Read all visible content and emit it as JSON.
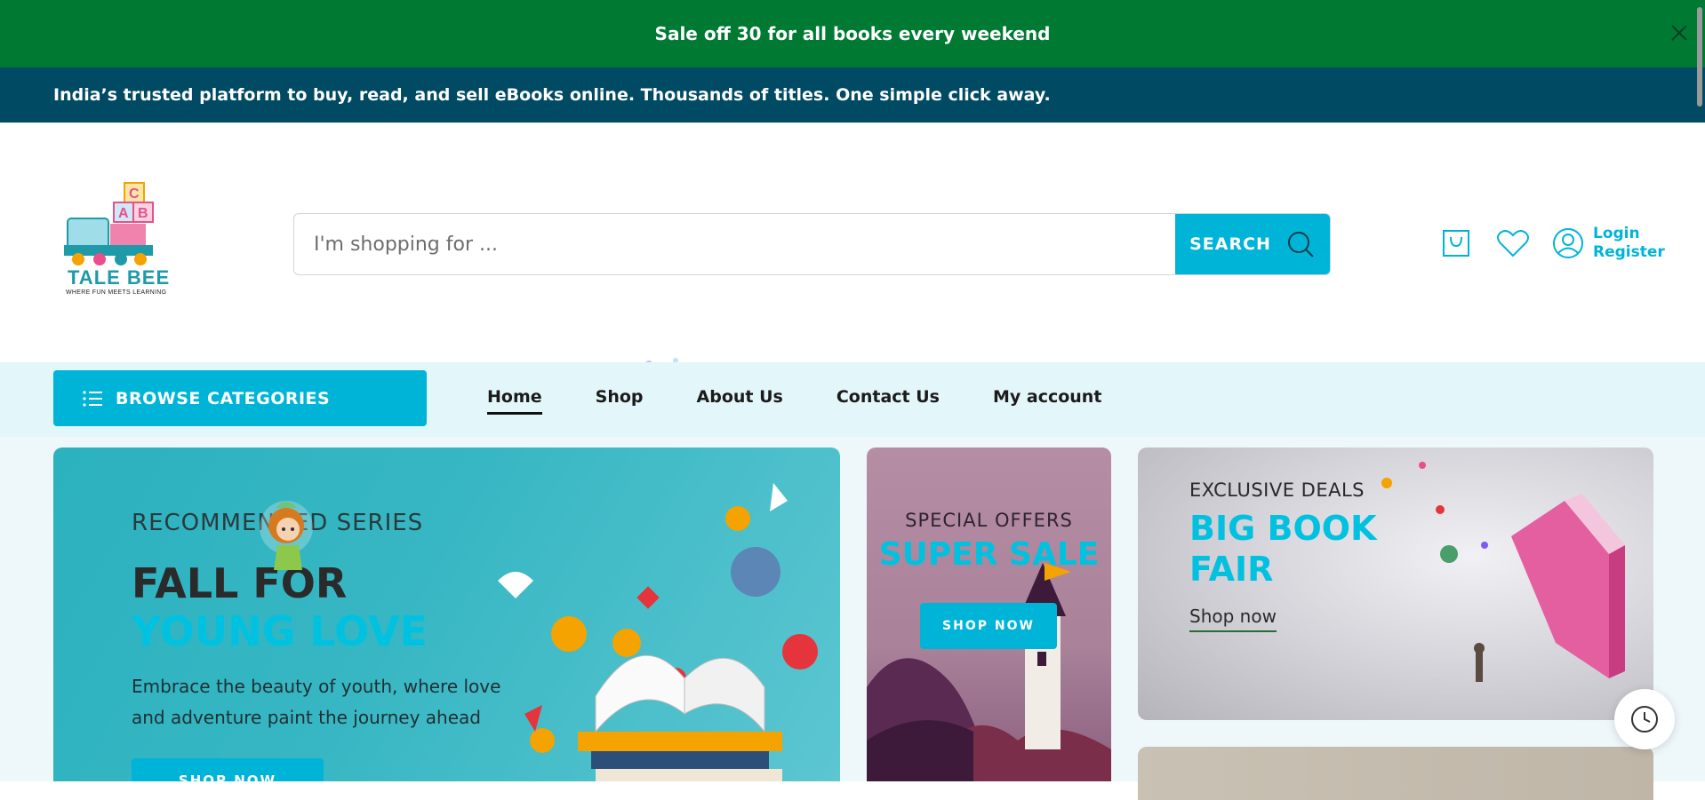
{
  "announcement": {
    "text": "Sale off 30 for all books every weekend"
  },
  "info_bar": {
    "text": "India’s trusted platform to buy, read, and sell eBooks online. Thousands of titles. One simple click away."
  },
  "logo": {
    "brand": "TALE BEE",
    "tagline": "WHERE FUN MEETS LEARNING"
  },
  "search": {
    "placeholder": "I'm shopping for ...",
    "button_label": "SEARCH"
  },
  "account": {
    "login": "Login",
    "register": "Register"
  },
  "nav": {
    "browse_label": "BROWSE CATEGORIES",
    "items": [
      {
        "label": "Home",
        "active": true
      },
      {
        "label": "Shop"
      },
      {
        "label": "About Us"
      },
      {
        "label": "Contact Us"
      },
      {
        "label": "My account"
      }
    ]
  },
  "banner_main": {
    "eyebrow": "RECOMMENDED SERIES",
    "title_line1": "FALL FOR",
    "title_line2": "YOUNG LOVE",
    "description": "Embrace the beauty of youth, where love and adventure paint the journey ahead",
    "button": "SHOP NOW"
  },
  "banner_mid": {
    "eyebrow": "SPECIAL OFFERS",
    "title": "SUPER SALE",
    "button": "SHOP NOW"
  },
  "banner_right": {
    "eyebrow": "EXCLUSIVE DEALS",
    "title": "BIG BOOK FAIR",
    "link": "Shop now"
  },
  "colors": {
    "green": "#007a33",
    "navy": "#004a63",
    "accent": "#00b4d8",
    "nav_bg": "#e3f6f9"
  }
}
